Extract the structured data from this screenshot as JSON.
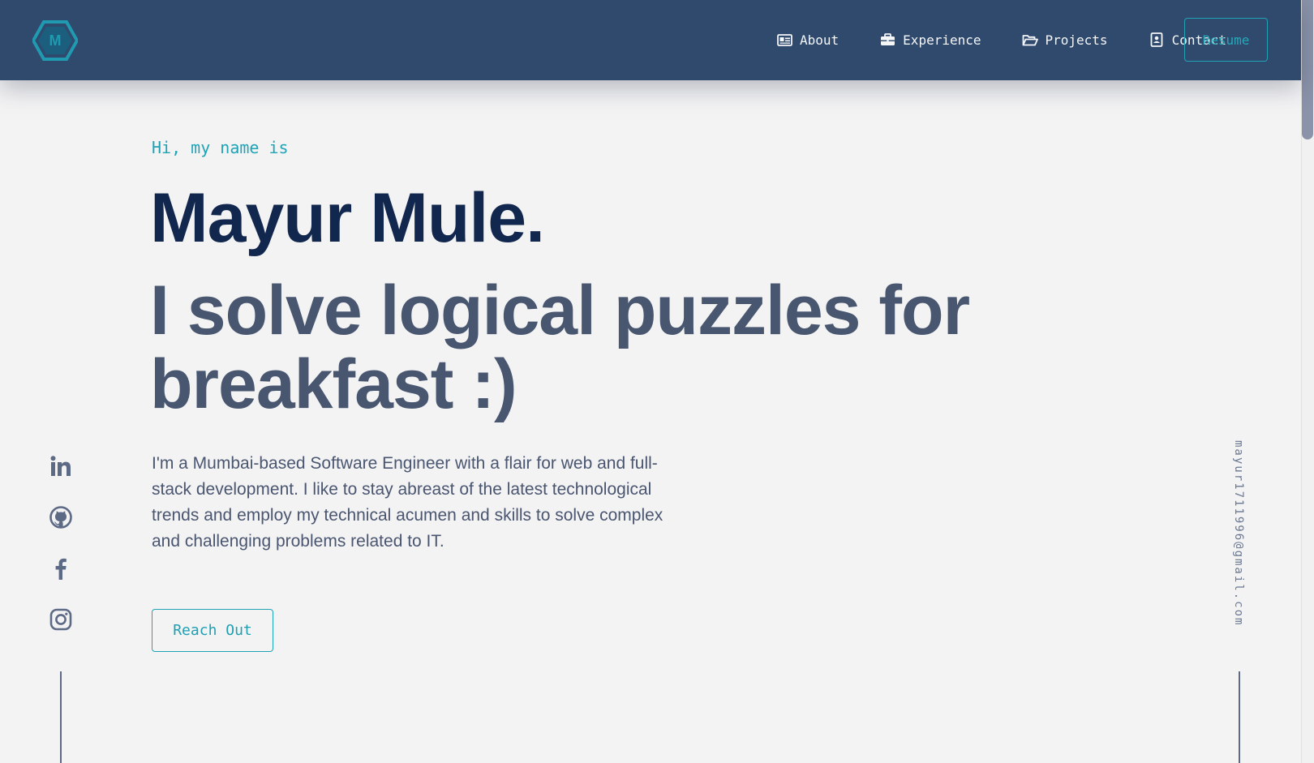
{
  "nav": {
    "logo_letter": "M",
    "items": [
      {
        "label": "About",
        "icon": "id-card-icon"
      },
      {
        "label": "Experience",
        "icon": "briefcase-icon"
      },
      {
        "label": "Projects",
        "icon": "folder-open-icon"
      },
      {
        "label": "Contact",
        "icon": "contact-book-icon"
      }
    ],
    "resume_label": "Resume"
  },
  "hero": {
    "greeting": "Hi, my name is",
    "name": "Mayur Mule.",
    "tagline": "I solve logical puzzles for breakfast :)",
    "description": "I'm a Mumbai-based Software Engineer with a flair for web and full-stack development. I like to stay abreast of the latest technological trends and employ my technical acumen and skills to solve complex and challenging problems related to IT.",
    "cta_label": "Reach Out"
  },
  "socials": [
    {
      "name": "linkedin-icon"
    },
    {
      "name": "github-icon"
    },
    {
      "name": "facebook-icon"
    },
    {
      "name": "instagram-icon"
    }
  ],
  "email": "mayur1711996@gmail.com",
  "colors": {
    "nav_bg": "#304a6e",
    "accent": "#1fa3b5",
    "name": "#12274d",
    "tagline": "#48566f",
    "body_text": "#4a5670",
    "page_bg": "#f3f3f4"
  }
}
